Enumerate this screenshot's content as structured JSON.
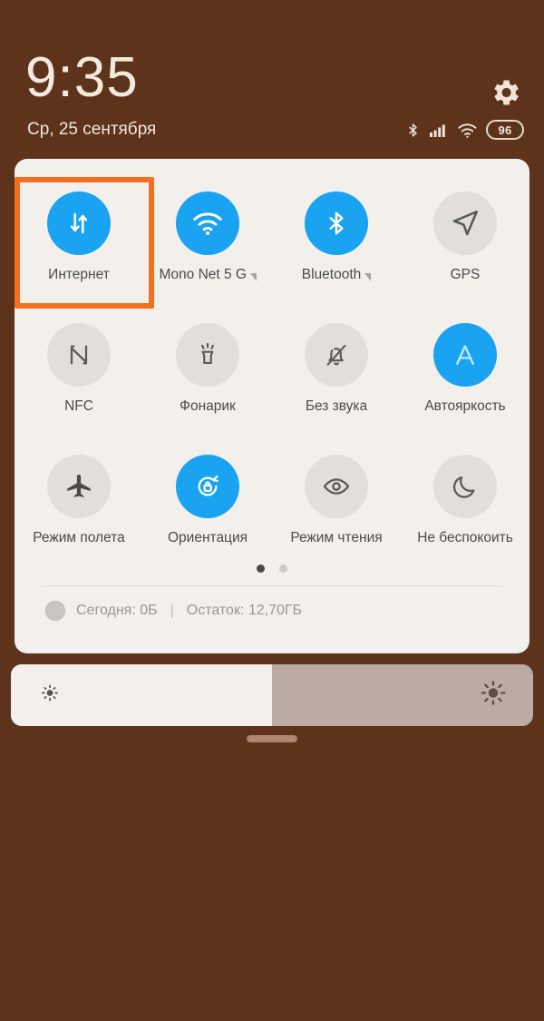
{
  "statusbar": {
    "time": "9:35",
    "date": "Ср, 25 сентября",
    "battery_percent": "96",
    "icons": [
      "bluetooth-icon",
      "cellular-signal-icon",
      "wifi-icon",
      "battery-icon",
      "gear-icon"
    ],
    "backdrop_color": "#5d331c"
  },
  "panel": {
    "background_color": "#f3f0ec",
    "active_color": "#1aa3f0",
    "inactive_color": "#e2dfdb",
    "highlight_color": "#f37021",
    "tiles": [
      {
        "label": "Интернет",
        "icon": "mobile-data-icon",
        "active": true,
        "highlighted": true,
        "caret": false
      },
      {
        "label": "Mono Net 5 G",
        "icon": "wifi-icon",
        "active": true,
        "highlighted": false,
        "caret": true
      },
      {
        "label": "Bluetooth",
        "icon": "bluetooth-icon",
        "active": true,
        "highlighted": false,
        "caret": true
      },
      {
        "label": "GPS",
        "icon": "location-arrow-icon",
        "active": false,
        "highlighted": false,
        "caret": false
      },
      {
        "label": "NFC",
        "icon": "nfc-icon",
        "active": false,
        "highlighted": false,
        "caret": false
      },
      {
        "label": "Фонарик",
        "icon": "flashlight-icon",
        "active": false,
        "highlighted": false,
        "caret": false
      },
      {
        "label": "Без звука",
        "icon": "bell-muted-icon",
        "active": false,
        "highlighted": false,
        "caret": false
      },
      {
        "label": "Автояркость",
        "icon": "auto-brightness-icon",
        "active": true,
        "highlighted": false,
        "caret": false
      },
      {
        "label": "Режим полета",
        "icon": "airplane-icon",
        "active": false,
        "highlighted": false,
        "caret": false
      },
      {
        "label": "Ориентация",
        "icon": "rotation-lock-icon",
        "active": true,
        "highlighted": false,
        "caret": false
      },
      {
        "label": "Режим чтения",
        "icon": "eye-icon",
        "active": false,
        "highlighted": false,
        "caret": false
      },
      {
        "label": "Не беспокоить",
        "icon": "moon-icon",
        "active": false,
        "highlighted": false,
        "caret": false
      }
    ],
    "pages": {
      "count": 2,
      "current": 1
    },
    "data_usage": {
      "today_label": "Сегодня: 0Б",
      "separator": "|",
      "remaining_label": "Остаток: 12,70ГБ"
    }
  },
  "brightness": {
    "value_percent": 50,
    "track_color": "#bcaba3",
    "fill_color": "#f3efeb",
    "low_icon": "brightness-low-icon",
    "high_icon": "brightness-high-icon"
  },
  "handle": {
    "name": "drag-handle"
  }
}
